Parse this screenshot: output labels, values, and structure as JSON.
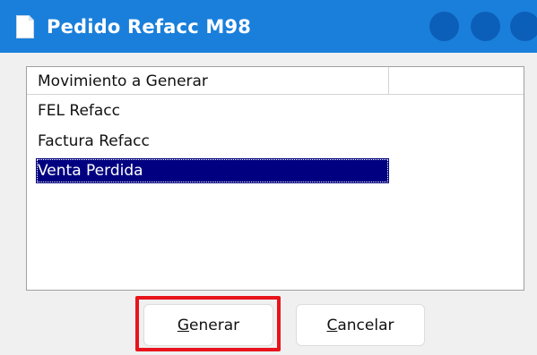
{
  "window": {
    "title": "Pedido Refacc M98",
    "icon": "document-icon",
    "colors": {
      "titlebar": "#1a7fdb",
      "title_dots": "#0c5fb8",
      "selection": "#000080",
      "highlight": "#e8131b"
    }
  },
  "list": {
    "column_header": "Movimiento a Generar",
    "items": [
      {
        "label": "FEL Refacc",
        "selected": false
      },
      {
        "label": "Factura Refacc",
        "selected": false
      },
      {
        "label": "Venta Perdida",
        "selected": true
      }
    ]
  },
  "buttons": {
    "generar": {
      "first": "G",
      "rest": "enerar"
    },
    "cancelar": {
      "first": "C",
      "rest": "ancelar"
    }
  }
}
